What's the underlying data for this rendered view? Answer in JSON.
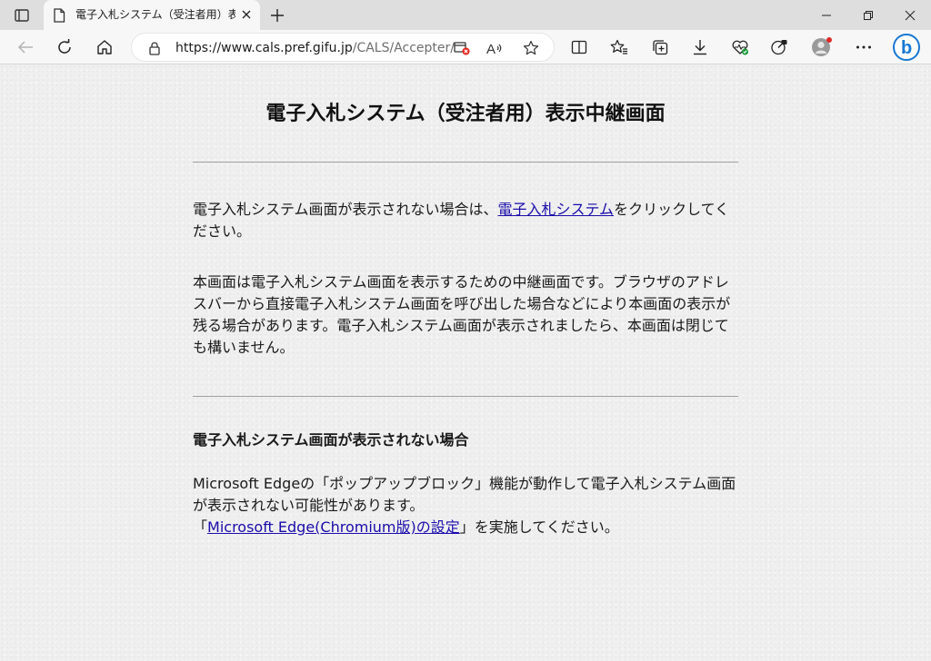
{
  "browser": {
    "tab_title": "電子入札システム（受注者用）表示中継画面",
    "url_host": "https://www.cals.pref.gifu.jp",
    "url_path": "/CALS/Accepter/",
    "read_aloud_label": "A",
    "bing_label": "b"
  },
  "page": {
    "title": "電子入札システム（受注者用）表示中継画面",
    "para1_before": "電子入札システム画面が表示されない場合は、",
    "para1_link": "電子入札システム",
    "para1_after": "をクリックしてください。",
    "para2": "本画面は電子入札システム画面を表示するための中継画面です。ブラウザのアドレスバーから直接電子入札システム画面を呼び出した場合などにより本画面の表示が残る場合があります。電子入札システム画面が表示されましたら、本画面は閉じても構いません。",
    "section_heading": "電子入札システム画面が表示されない場合",
    "para3_line1": "Microsoft Edgeの「ポップアップブロック」機能が動作して電子入札システム画面が表示されない可能性があります。",
    "para3_open": "「",
    "para3_link": "Microsoft Edge(Chromium版)の設定",
    "para3_after": "」を実施してください。"
  },
  "colors": {
    "link": "#1a0dab",
    "rule": "#a0a0a0",
    "tabstrip": "#dedede",
    "bing_accent": "#1877d2"
  }
}
